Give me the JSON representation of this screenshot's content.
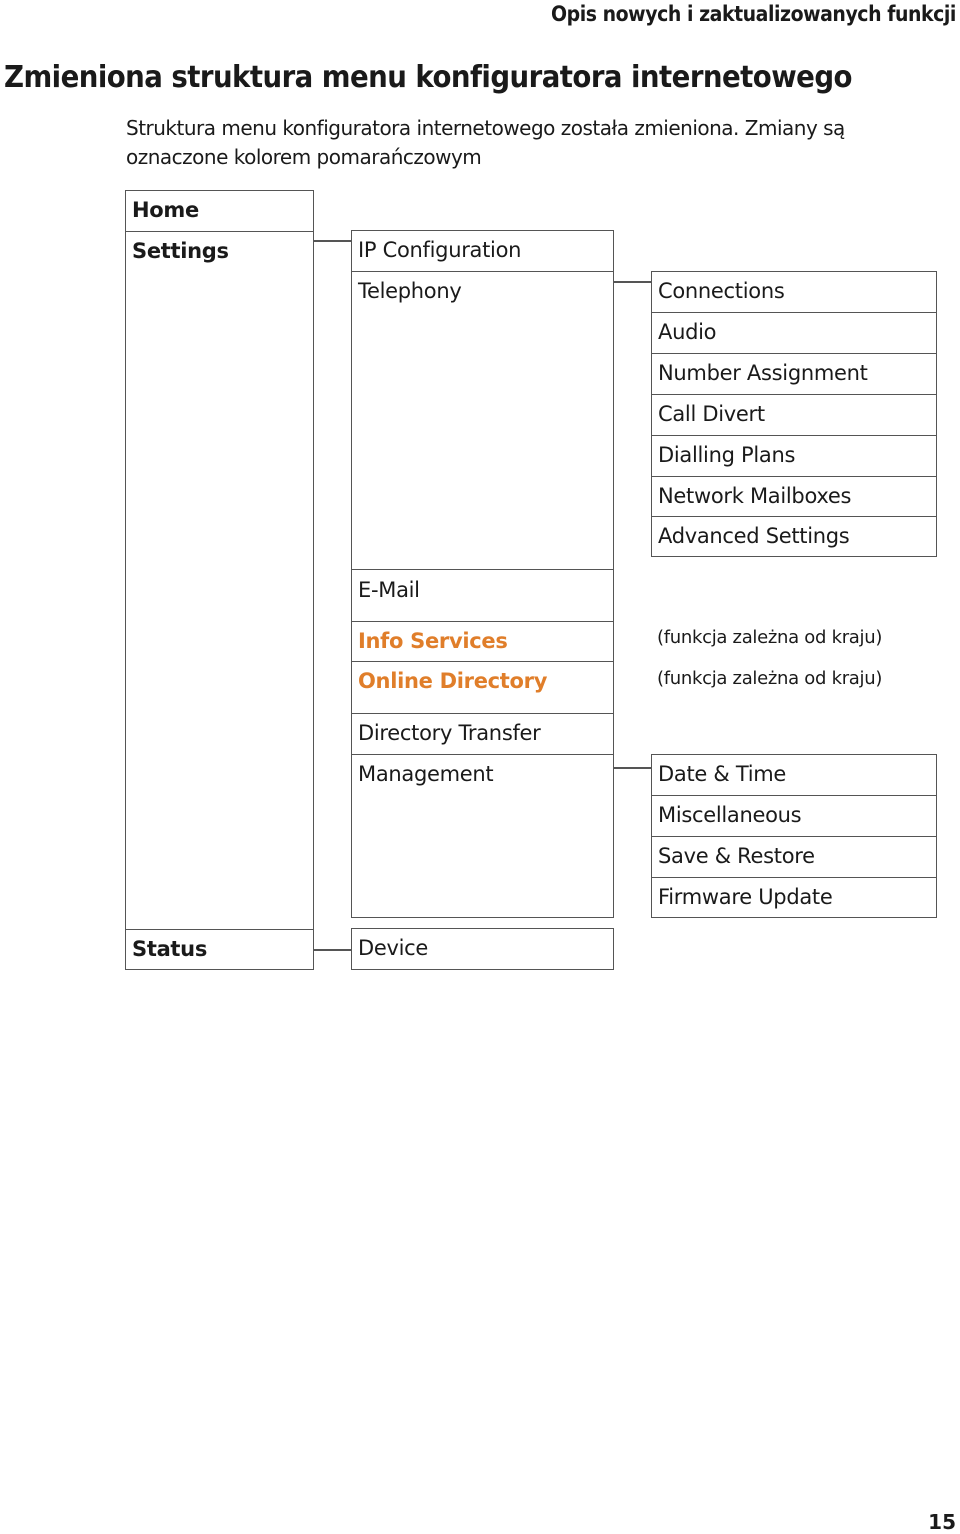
{
  "header": {
    "section": "Opis nowych i zaktualizowanych funkcji"
  },
  "title": "Zmieniona struktura menu konfiguratora internetowego",
  "intro": "Struktura menu konfiguratora internetowego została zmieniona. Zmiany są oznaczone kolorem pomarańczowym",
  "colors": {
    "highlight": "#e07e2a",
    "text": "#1a1a1a",
    "border": "#555555"
  },
  "menu": {
    "level1": [
      "Home",
      "Settings",
      "Status"
    ],
    "settings": [
      "IP Configuration",
      "Telephony",
      "E-Mail",
      "Info Services",
      "Online Directory",
      "Directory Transfer",
      "Management"
    ],
    "telephony": [
      "Connections",
      "Audio",
      "Number Assignment",
      "Call Divert",
      "Dialling Plans",
      "Network Mailboxes",
      "Advanced Settings"
    ],
    "management": [
      "Date & Time",
      "Miscellaneous",
      "Save & Restore",
      "Firmware Update"
    ],
    "status": [
      "Device"
    ],
    "changed": [
      "Info Services",
      "Online Directory"
    ],
    "notes": {
      "info_services": "(funkcja zależna od kraju)",
      "online_directory": "(funkcja zależna od kraju)"
    }
  },
  "page_number": "15"
}
